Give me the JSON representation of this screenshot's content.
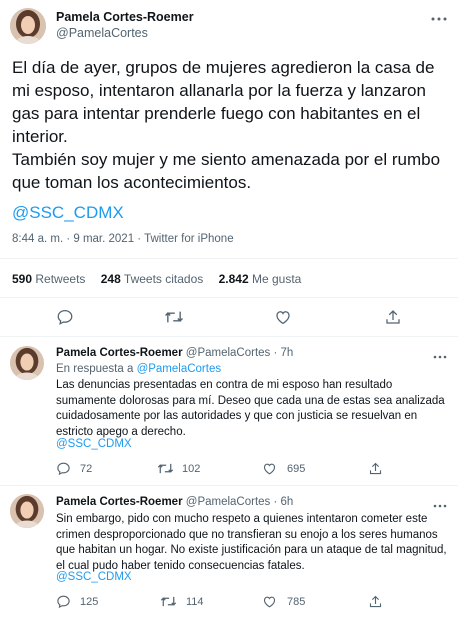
{
  "main_tweet": {
    "author_name": "Pamela Cortes-Roemer",
    "author_handle": "@PamelaCortes",
    "text": "El día de ayer, grupos de mujeres agredieron la casa de mi esposo, intentaron allanarla por la fuerza y lanzaron gas para intentar prenderle fuego con habitantes en el interior.\nTambién soy mujer y me siento amenazada por el rumbo que toman los acontecimientos.",
    "mention": "@SSC_CDMX",
    "timestamp": "8:44 a. m. · 9 mar. 2021 · Twitter for iPhone",
    "retweets_count": "590",
    "retweets_label": "Retweets",
    "quotes_count": "248",
    "quotes_label": "Tweets citados",
    "likes_count": "2.842",
    "likes_label": "Me gusta"
  },
  "replies": [
    {
      "author_name": "Pamela Cortes-Roemer",
      "author_handle": "@PamelaCortes · 7h",
      "reply_to_label": "En respuesta a",
      "reply_to_handle": "@PamelaCortes",
      "text": "Las denuncias presentadas en contra de mi esposo han resultado sumamente dolorosas para mí. Deseo que cada una de estas sea analizada cuidadosamente por las autoridades y que con justicia se resuelvan en estricto apego a derecho.",
      "mention": "@SSC_CDMX",
      "replies_count": "72",
      "retweets_count": "102",
      "likes_count": "695"
    },
    {
      "author_name": "Pamela Cortes-Roemer",
      "author_handle": "@PamelaCortes · 6h",
      "text": "Sin embargo, pido con mucho respeto a quienes intentaron cometer este crimen desproporcionado que no transfieran su enojo a los seres humanos que habitan un hogar. No existe justificación para un ataque de tal magnitud, el cual pudo haber tenido consecuencias fatales.",
      "mention": "@SSC_CDMX",
      "replies_count": "125",
      "retweets_count": "114",
      "likes_count": "785"
    }
  ],
  "icons": [
    "more-icon",
    "reply-icon",
    "retweet-icon",
    "like-icon",
    "share-icon"
  ],
  "colors": {
    "link": "#1d9bf0",
    "secondary": "#536471",
    "divider": "#eff3f4"
  }
}
